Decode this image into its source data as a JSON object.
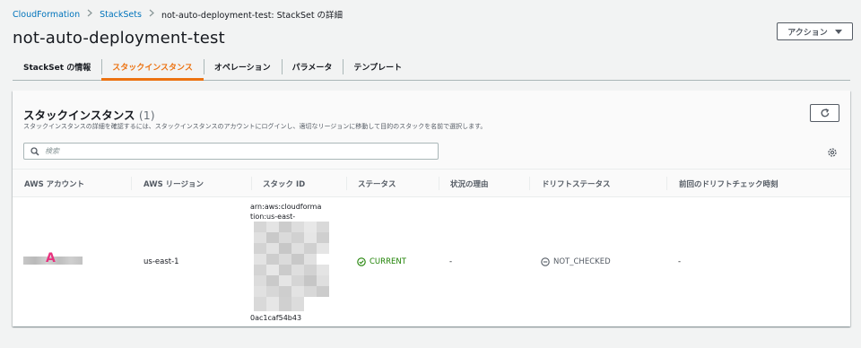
{
  "breadcrumb": {
    "root": "CloudFormation",
    "stacksets": "StackSets",
    "current": "not-auto-deployment-test: StackSet の詳細"
  },
  "page": {
    "title": "not-auto-deployment-test"
  },
  "actions": {
    "label": "アクション"
  },
  "tabs": [
    {
      "label": "StackSet の情報",
      "active": false
    },
    {
      "label": "スタックインスタンス",
      "active": true
    },
    {
      "label": "オペレーション",
      "active": false
    },
    {
      "label": "パラメータ",
      "active": false
    },
    {
      "label": "テンプレート",
      "active": false
    }
  ],
  "panel": {
    "title": "スタックインスタンス",
    "count": "(1)",
    "description": "スタックインスタンスの詳細を確認するには、スタックインスタンスのアカウントにログインし、適切なリージョンに移動して目的のスタックを名前で選択します。",
    "search_placeholder": "検索"
  },
  "table": {
    "columns": [
      "AWS アカウント",
      "AWS リージョン",
      "スタック ID",
      "ステータス",
      "状況の理由",
      "ドリフトステータス",
      "前回のドリフトチェック時刻"
    ],
    "rows": [
      {
        "account_mark": "A",
        "region": "us-east-1",
        "stack_id_top": "arn:aws:cloudforma tion:us-east-",
        "stack_id_bottom": "0ac1caf54b43",
        "status": "CURRENT",
        "status_reason": "-",
        "drift_status": "NOT_CHECKED",
        "last_drift_check": "-"
      }
    ]
  },
  "colors": {
    "accent": "#ec7211",
    "link": "#0073bb",
    "success": "#1d8102",
    "mark": "#e8337f"
  }
}
